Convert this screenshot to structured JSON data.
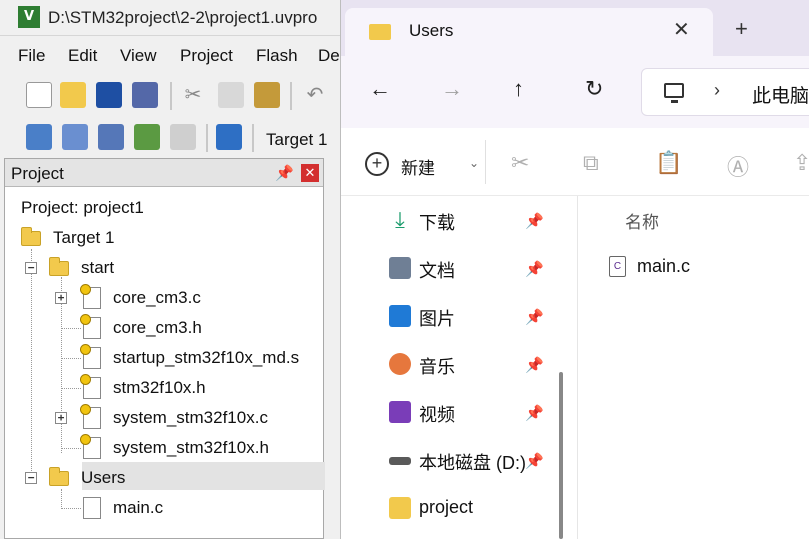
{
  "keil": {
    "title": "D:\\STM32project\\2-2\\project1.uvpro",
    "app_icon": "keil-uv-icon",
    "menu": [
      "File",
      "Edit",
      "View",
      "Project",
      "Flash",
      "De"
    ],
    "target": "Target 1",
    "project_panel": {
      "title": "Project",
      "root": "Project: project1",
      "target": "Target 1",
      "groups": [
        {
          "name": "start",
          "files": [
            "core_cm3.c",
            "core_cm3.h",
            "startup_stm32f10x_md.s",
            "stm32f10x.h",
            "system_stm32f10x.c",
            "system_stm32f10x.h"
          ]
        },
        {
          "name": "Users",
          "files": [
            "main.c"
          ]
        }
      ]
    },
    "colors": {
      "close": "#d32f2f",
      "folder": "#f2c94c"
    }
  },
  "explorer": {
    "tab_title": "Users",
    "new_tab": "+",
    "address": "此电脑",
    "toolbar": {
      "new_label": "新建"
    },
    "nav_items": [
      {
        "label": "下载",
        "icon": "download-icon"
      },
      {
        "label": "文档",
        "icon": "document-icon"
      },
      {
        "label": "图片",
        "icon": "pictures-icon"
      },
      {
        "label": "音乐",
        "icon": "music-icon"
      },
      {
        "label": "视频",
        "icon": "video-icon"
      },
      {
        "label": "本地磁盘 (D:)",
        "icon": "drive-icon"
      },
      {
        "label": "project",
        "icon": "folder-icon"
      }
    ],
    "column_header": "名称",
    "files": [
      "main.c"
    ],
    "colors": {
      "accent": "#e8e3f1"
    }
  }
}
